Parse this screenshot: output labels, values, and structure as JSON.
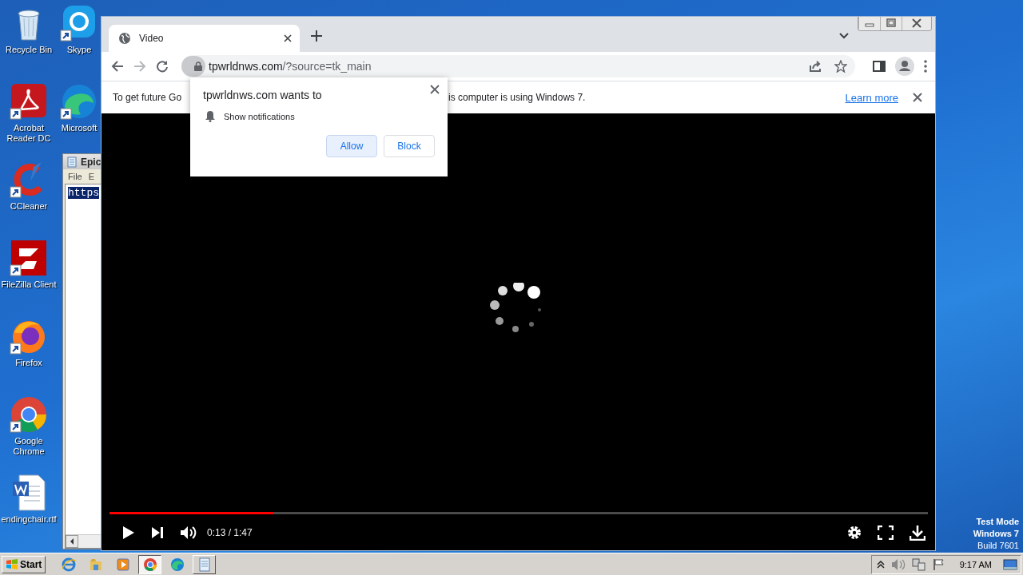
{
  "desktop": {
    "icons": [
      {
        "label": "Recycle Bin",
        "kind": "recycle",
        "shortcut": false
      },
      {
        "label": "Acrobat Reader DC",
        "kind": "acrobat",
        "shortcut": true
      },
      {
        "label": "CCleaner",
        "kind": "ccleaner",
        "shortcut": true
      },
      {
        "label": "FileZilla Client",
        "kind": "filezilla",
        "shortcut": true
      },
      {
        "label": "Firefox",
        "kind": "firefox",
        "shortcut": true
      },
      {
        "label": "Google Chrome",
        "kind": "chrome",
        "shortcut": true
      },
      {
        "label": "endingchair.rtf",
        "kind": "word",
        "shortcut": false
      },
      {
        "label": "Skype",
        "kind": "skype",
        "shortcut": true
      },
      {
        "label": "Microsoft",
        "kind": "edge",
        "shortcut": true
      }
    ],
    "system_notice": [
      "Test Mode",
      "Windows 7",
      "Build 7601"
    ]
  },
  "notepad": {
    "title": "Epic",
    "menu": [
      "File",
      "E"
    ],
    "text": "https"
  },
  "browser": {
    "tab": {
      "title": "Video"
    },
    "address": {
      "host": "tpwrldnws.com",
      "path": "/?source=tk_main"
    },
    "infobar": {
      "text_start": "To get future Go",
      "text_end": "is computer is using Windows 7.",
      "link": "Learn more"
    },
    "permission_popup": {
      "title": "tpwrldnws.com wants to",
      "permission": "Show notifications",
      "buttons": [
        {
          "label": "Allow",
          "kind": "primary"
        },
        {
          "label": "Block",
          "kind": "secondary"
        }
      ]
    },
    "player": {
      "progress": {
        "level": 0.2
      },
      "time": "0:13 / 1:47"
    }
  },
  "taskbar": {
    "start": "Start",
    "apps": [
      {
        "kind": "ie",
        "selected": false,
        "open": false
      },
      {
        "kind": "explorer",
        "selected": false,
        "open": false
      },
      {
        "kind": "media",
        "selected": false,
        "open": false
      },
      {
        "kind": "chrome",
        "selected": true,
        "open": true
      },
      {
        "kind": "edge",
        "selected": false,
        "open": false
      },
      {
        "kind": "notepad",
        "selected": false,
        "open": true
      }
    ],
    "clock": "9:17 AM"
  }
}
